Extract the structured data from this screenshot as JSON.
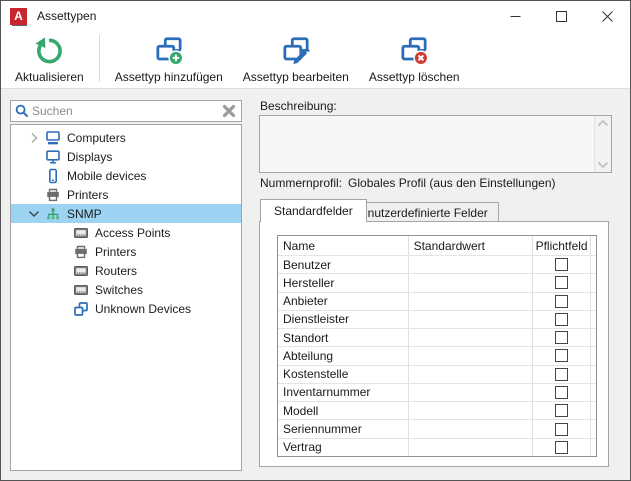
{
  "window": {
    "title": "Assettypen"
  },
  "toolbar": {
    "buttons": [
      {
        "label": "Aktualisieren",
        "icon": "refresh-icon"
      },
      {
        "label": "Assettyp hinzufügen",
        "icon": "asset-add-icon"
      },
      {
        "label": "Assettyp bearbeiten",
        "icon": "asset-edit-icon"
      },
      {
        "label": "Assettyp löschen",
        "icon": "asset-delete-icon"
      }
    ]
  },
  "sidebar": {
    "search": {
      "placeholder": "Suchen"
    },
    "tree": [
      {
        "label": "Computers",
        "level": 0,
        "state": "collapsed",
        "icon": "computer"
      },
      {
        "label": "Displays",
        "level": 0,
        "icon": "display"
      },
      {
        "label": "Mobile devices",
        "level": 0,
        "icon": "mobile-device"
      },
      {
        "label": "Printers",
        "level": 0,
        "icon": "printer"
      },
      {
        "label": "SNMP",
        "level": 0,
        "state": "expanded",
        "selected": true,
        "icon": "snmp-network"
      },
      {
        "label": "Access Points",
        "level": 1,
        "icon": "network-device"
      },
      {
        "label": "Printers",
        "level": 1,
        "icon": "printer"
      },
      {
        "label": "Routers",
        "level": 1,
        "icon": "network-device"
      },
      {
        "label": "Switches",
        "level": 1,
        "icon": "network-device"
      },
      {
        "label": "Unknown Devices",
        "level": 1,
        "icon": "unknown-device"
      }
    ]
  },
  "main": {
    "description_label": "Beschreibung:",
    "description_value": "",
    "number_profile_label": "Nummernprofil:",
    "number_profile_value": "Globales Profil (aus den Einstellungen)",
    "tabs": [
      {
        "label": "Standardfelder",
        "active": true
      },
      {
        "label": "Benutzerdefinierte Felder",
        "active": false
      }
    ],
    "table": {
      "columns": [
        "Name",
        "Standardwert",
        "Pflichtfeld"
      ],
      "rows": [
        {
          "name": "Benutzer",
          "default_value": "",
          "required": false
        },
        {
          "name": "Hersteller",
          "default_value": "",
          "required": false
        },
        {
          "name": "Anbieter",
          "default_value": "",
          "required": false
        },
        {
          "name": "Dienstleister",
          "default_value": "",
          "required": false
        },
        {
          "name": "Standort",
          "default_value": "",
          "required": false
        },
        {
          "name": "Abteilung",
          "default_value": "",
          "required": false
        },
        {
          "name": "Kostenstelle",
          "default_value": "",
          "required": false
        },
        {
          "name": "Inventarnummer",
          "default_value": "",
          "required": false
        },
        {
          "name": "Modell",
          "default_value": "",
          "required": false
        },
        {
          "name": "Seriennummer",
          "default_value": "",
          "required": false
        },
        {
          "name": "Vertrag",
          "default_value": "",
          "required": false
        }
      ]
    }
  },
  "colors": {
    "accent_blue": "#2b6db8",
    "green": "#35a86e",
    "red": "#d23b32",
    "selection_blue": "#9dd3f2",
    "window_bg": "#f0f0f0"
  }
}
